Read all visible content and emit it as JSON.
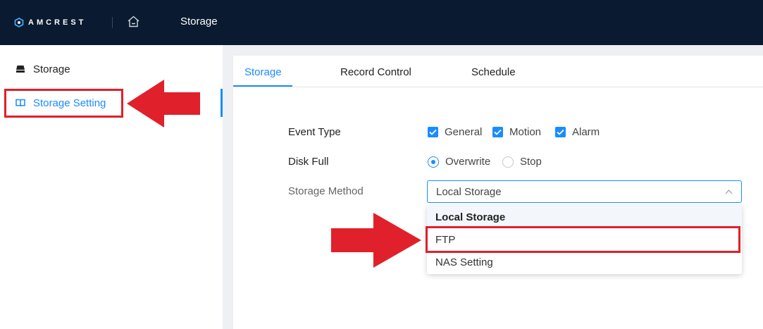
{
  "header": {
    "brand": "AMCREST",
    "title": "Storage"
  },
  "sidebar": {
    "items": [
      {
        "label": "Storage",
        "icon": "hard-drive-icon"
      },
      {
        "label": "Storage Setting",
        "icon": "book-icon",
        "active": true
      }
    ]
  },
  "tabs": [
    {
      "label": "Storage",
      "active": true
    },
    {
      "label": "Record Control"
    },
    {
      "label": "Schedule"
    }
  ],
  "form": {
    "event_type": {
      "label": "Event Type",
      "options": [
        {
          "label": "General",
          "checked": true
        },
        {
          "label": "Motion",
          "checked": true
        },
        {
          "label": "Alarm",
          "checked": true
        }
      ]
    },
    "disk_full": {
      "label": "Disk Full",
      "options": [
        {
          "label": "Overwrite",
          "selected": true
        },
        {
          "label": "Stop",
          "selected": false
        }
      ]
    },
    "storage_method": {
      "label": "Storage Method",
      "value": "Local Storage",
      "options": [
        "Local Storage",
        "FTP",
        "NAS Setting"
      ]
    }
  },
  "colors": {
    "accent": "#1a8cff",
    "topbar": "#0a1a30",
    "annotation": "#e0202a"
  }
}
